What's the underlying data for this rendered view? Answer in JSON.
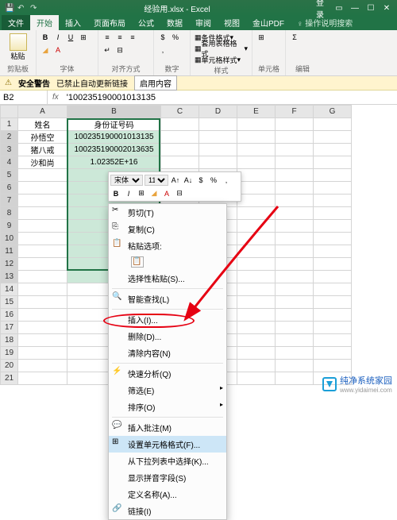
{
  "app": {
    "title": "经验用.xlsx - Excel",
    "login": "登录"
  },
  "tabs": {
    "file": "文件",
    "items": [
      "开始",
      "插入",
      "页面布局",
      "公式",
      "数据",
      "审阅",
      "视图",
      "金山PDF"
    ],
    "active": 0,
    "help": "操作说明搜索"
  },
  "ribbon": {
    "clipboard": {
      "paste": "粘贴",
      "label": "剪贴板"
    },
    "font": {
      "bold": "B",
      "italic": "I",
      "underline": "U",
      "label": "字体"
    },
    "align": {
      "label": "对齐方式"
    },
    "number": {
      "label": "数字"
    },
    "styles": {
      "cond": "条件格式",
      "table": "套用表格格式",
      "cell": "单元格样式",
      "label": "样式"
    },
    "cells": {
      "label": "单元格"
    },
    "edit": {
      "label": "编辑"
    }
  },
  "warn": {
    "icon": "安全警告",
    "msg": "已禁止自动更新链接",
    "btn": "启用内容"
  },
  "fx": {
    "cell": "B2",
    "formula": "'100235190001013135"
  },
  "cols": [
    "A",
    "B",
    "C",
    "D",
    "E",
    "F",
    "G"
  ],
  "data": {
    "h1": "姓名",
    "h2": "身份证号码",
    "r": [
      [
        "孙悟空",
        "100235190001013135"
      ],
      [
        "猪八戒",
        "100235190002013635"
      ],
      [
        "沙和尚",
        "1.02352E+16"
      ]
    ]
  },
  "minitoolbar": {
    "font": "宋体",
    "size": "11"
  },
  "ctx": {
    "cut": "剪切(T)",
    "copy": "复制(C)",
    "pasteopt": "粘贴选项:",
    "pspecial": "选择性粘贴(S)...",
    "smart": "智能查找(L)",
    "insert": "插入(I)...",
    "delete": "删除(D)...",
    "clear": "清除内容(N)",
    "quick": "快速分析(Q)",
    "filter": "筛选(E)",
    "sort": "排序(O)",
    "comment": "插入批注(M)",
    "format": "设置单元格格式(F)...",
    "dropdown": "从下拉列表中选择(K)...",
    "phonetic": "显示拼音字段(S)",
    "name": "定义名称(A)...",
    "link": "链接(I)"
  },
  "watermark": {
    "brand": "纯净系统家园",
    "url": "www.yidaimei.com"
  }
}
